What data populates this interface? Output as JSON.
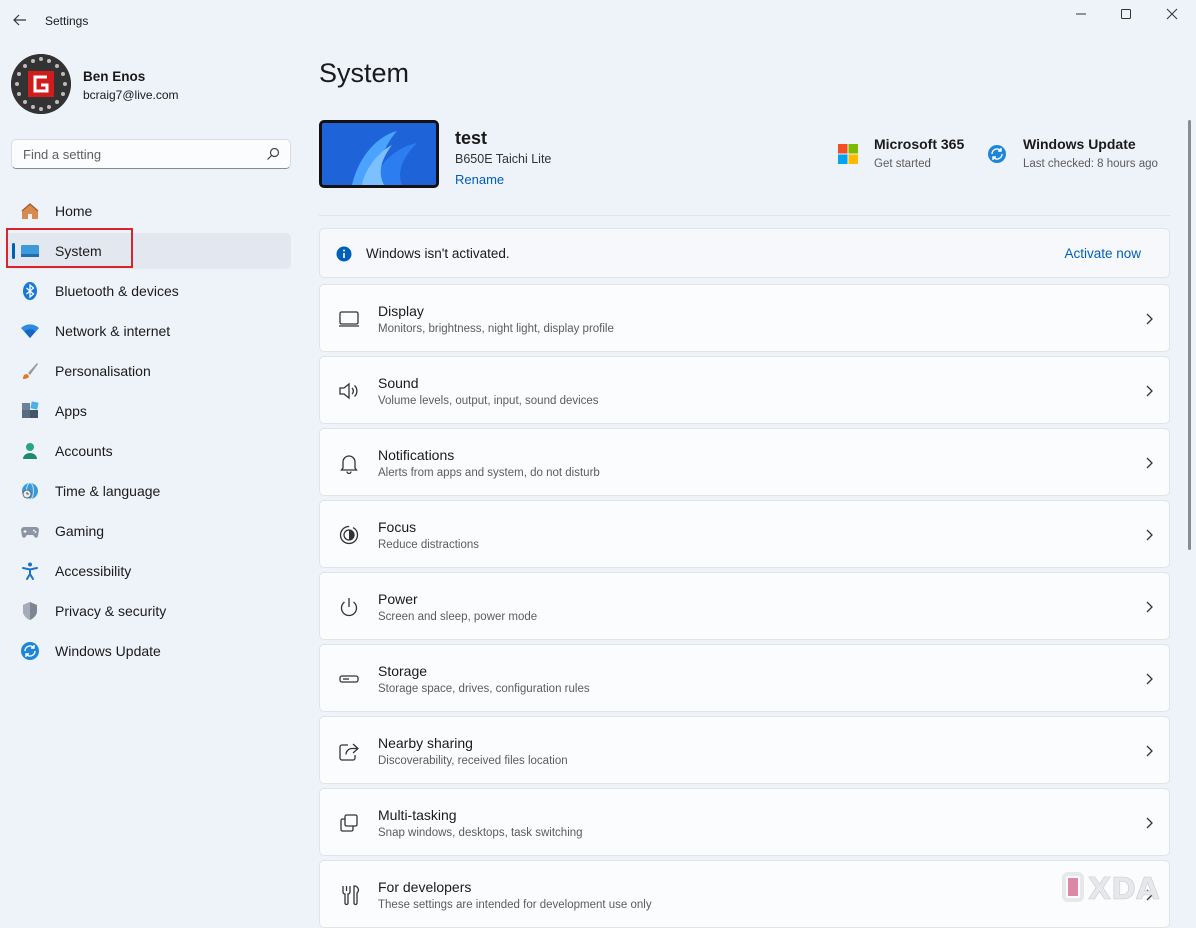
{
  "window": {
    "title": "Settings"
  },
  "profile": {
    "name": "Ben Enos",
    "email": "bcraig7@live.com"
  },
  "search": {
    "placeholder": "Find a setting"
  },
  "sidebar": {
    "items": [
      {
        "label": "Home",
        "icon": "home-icon"
      },
      {
        "label": "System",
        "icon": "system-icon",
        "active": true
      },
      {
        "label": "Bluetooth & devices",
        "icon": "bluetooth-icon"
      },
      {
        "label": "Network & internet",
        "icon": "wifi-icon"
      },
      {
        "label": "Personalisation",
        "icon": "brush-icon"
      },
      {
        "label": "Apps",
        "icon": "apps-icon"
      },
      {
        "label": "Accounts",
        "icon": "accounts-icon"
      },
      {
        "label": "Time & language",
        "icon": "globe-clock-icon"
      },
      {
        "label": "Gaming",
        "icon": "gamepad-icon"
      },
      {
        "label": "Accessibility",
        "icon": "accessibility-icon"
      },
      {
        "label": "Privacy & security",
        "icon": "shield-icon"
      },
      {
        "label": "Windows Update",
        "icon": "update-icon"
      }
    ]
  },
  "main": {
    "title": "System",
    "device": {
      "name": "test",
      "model": "B650E Taichi Lite",
      "rename_label": "Rename"
    },
    "quick_links": [
      {
        "title": "Microsoft 365",
        "subtitle": "Get started",
        "icon": "microsoft-365-icon"
      },
      {
        "title": "Windows Update",
        "subtitle": "Last checked: 8 hours ago",
        "icon": "update-icon"
      }
    ],
    "activation": {
      "message": "Windows isn't activated.",
      "action": "Activate now"
    },
    "settings": [
      {
        "title": "Display",
        "description": "Monitors, brightness, night light, display profile",
        "icon": "display-icon"
      },
      {
        "title": "Sound",
        "description": "Volume levels, output, input, sound devices",
        "icon": "speaker-icon"
      },
      {
        "title": "Notifications",
        "description": "Alerts from apps and system, do not disturb",
        "icon": "bell-icon"
      },
      {
        "title": "Focus",
        "description": "Reduce distractions",
        "icon": "focus-icon"
      },
      {
        "title": "Power",
        "description": "Screen and sleep, power mode",
        "icon": "power-icon"
      },
      {
        "title": "Storage",
        "description": "Storage space, drives, configuration rules",
        "icon": "storage-icon"
      },
      {
        "title": "Nearby sharing",
        "description": "Discoverability, received files location",
        "icon": "share-icon"
      },
      {
        "title": "Multi-tasking",
        "description": "Snap windows, desktops, task switching",
        "icon": "multitasking-icon"
      },
      {
        "title": "For developers",
        "description": "These settings are intended for development use only",
        "icon": "developer-tools-icon"
      }
    ]
  },
  "watermark": {
    "text": "XDA"
  },
  "colors": {
    "accent": "#005fb8",
    "highlight": "#d9232d",
    "background": "#eef2f9"
  }
}
